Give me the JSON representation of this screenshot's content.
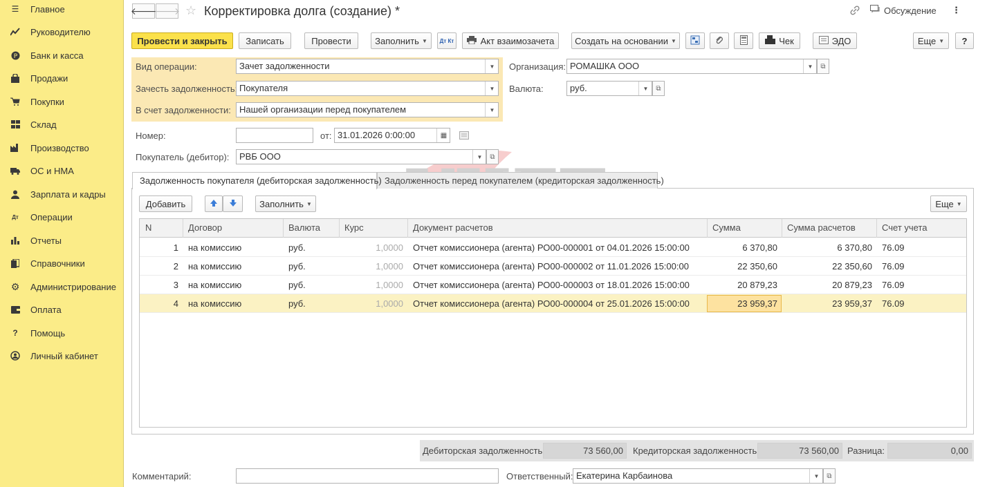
{
  "sidebar": {
    "items": [
      {
        "label": "Главное",
        "icon": "menu-lines-icon"
      },
      {
        "label": "Руководителю",
        "icon": "trend-chart-icon"
      },
      {
        "label": "Банк и касса",
        "icon": "coin-icon"
      },
      {
        "label": "Продажи",
        "icon": "shopping-bag-icon"
      },
      {
        "label": "Покупки",
        "icon": "cart-icon"
      },
      {
        "label": "Склад",
        "icon": "warehouse-grid-icon"
      },
      {
        "label": "Производство",
        "icon": "factory-icon"
      },
      {
        "label": "ОС и НМА",
        "icon": "truck-icon"
      },
      {
        "label": "Зарплата и кадры",
        "icon": "person-icon"
      },
      {
        "label": "Операции",
        "icon": "dt-kt-icon"
      },
      {
        "label": "Отчеты",
        "icon": "bar-chart-icon"
      },
      {
        "label": "Справочники",
        "icon": "books-icon"
      },
      {
        "label": "Администрирование",
        "icon": "gear-icon"
      },
      {
        "label": "Оплата",
        "icon": "wallet-icon"
      },
      {
        "label": "Помощь",
        "icon": "question-icon"
      },
      {
        "label": "Личный кабинет",
        "icon": "user-circle-icon"
      }
    ]
  },
  "header": {
    "title": "Корректировка долга (создание) *",
    "discussion": "Обсуждение",
    "more": "⋮"
  },
  "toolbar": {
    "post_close": "Провести и закрыть",
    "save": "Записать",
    "post": "Провести",
    "fill": "Заполнить",
    "dtkt": "Дт Кт",
    "offset_act": "Акт взаимозачета",
    "create_based": "Создать на основании",
    "receipt": "Чек",
    "edo": "ЭДО",
    "more": "Еще",
    "help": "?"
  },
  "form": {
    "operation_type_label": "Вид операции:",
    "operation_type": "Зачет задолженности",
    "offset_debt_label": "Зачесть задолженность:",
    "offset_debt": "Покупателя",
    "against_debt_label": "В счет задолженности:",
    "against_debt": "Нашей организации перед покупателем",
    "organization_label": "Организация:",
    "organization": "РОМАШКА ООО",
    "currency_label": "Валюта:",
    "currency": "руб.",
    "number_label": "Номер:",
    "number": "",
    "date_label": "от:",
    "date": "31.01.2026  0:00:00",
    "buyer_label": "Покупатель (дебитор):",
    "buyer": "РВБ ООО"
  },
  "tabs": [
    {
      "label": "Задолженность покупателя (дебиторская задолженность)",
      "active": true
    },
    {
      "label": "Задолженность перед покупателем (кредиторская задолженность)",
      "active": false
    }
  ],
  "table_toolbar": {
    "add": "Добавить",
    "fill": "Заполнить",
    "more": "Еще"
  },
  "table": {
    "columns": [
      "N",
      "Договор",
      "Валюта",
      "Курс",
      "Документ расчетов",
      "Сумма",
      "Сумма расчетов",
      "Счет учета"
    ],
    "rows": [
      {
        "n": "1",
        "contract": "на комиссию",
        "currency": "руб.",
        "rate": "1,0000",
        "doc": "Отчет комиссионера (агента) РО00-000001 от 04.01.2026 15:00:00",
        "sum": "6 370,80",
        "settle_sum": "6 370,80",
        "account": "76.09"
      },
      {
        "n": "2",
        "contract": "на комиссию",
        "currency": "руб.",
        "rate": "1,0000",
        "doc": "Отчет комиссионера (агента) РО00-000002 от 11.01.2026 15:00:00",
        "sum": "22 350,60",
        "settle_sum": "22 350,60",
        "account": "76.09"
      },
      {
        "n": "3",
        "contract": "на комиссию",
        "currency": "руб.",
        "rate": "1,0000",
        "doc": "Отчет комиссионера (агента) РО00-000003 от 18.01.2026 15:00:00",
        "sum": "20 879,23",
        "settle_sum": "20 879,23",
        "account": "76.09"
      },
      {
        "n": "4",
        "contract": "на комиссию",
        "currency": "руб.",
        "rate": "1,0000",
        "doc": "Отчет комиссионера (агента) РО00-000004 от 25.01.2026 15:00:00",
        "sum": "23 959,37",
        "settle_sum": "23 959,37",
        "account": "76.09"
      }
    ]
  },
  "totals": {
    "receivable_label": "Дебиторская задолженность:",
    "receivable": "73 560,00",
    "payable_label": "Кредиторская задолженность:",
    "payable": "73 560,00",
    "diff_label": "Разница:",
    "diff": "0,00"
  },
  "footer": {
    "comment_label": "Комментарий:",
    "comment": "",
    "responsible_label": "Ответственный:",
    "responsible": "Екатерина Карбаинова"
  },
  "watermark": {
    "line1": "УЧЕТ",
    "line2": "БЕЗ ЗАБОТ"
  },
  "colors": {
    "sidebar_bg": "#fbec88",
    "primary_button": "#fbe14b",
    "highlight_block": "#fbe8b4",
    "selected_row": "#fbf2c3"
  }
}
